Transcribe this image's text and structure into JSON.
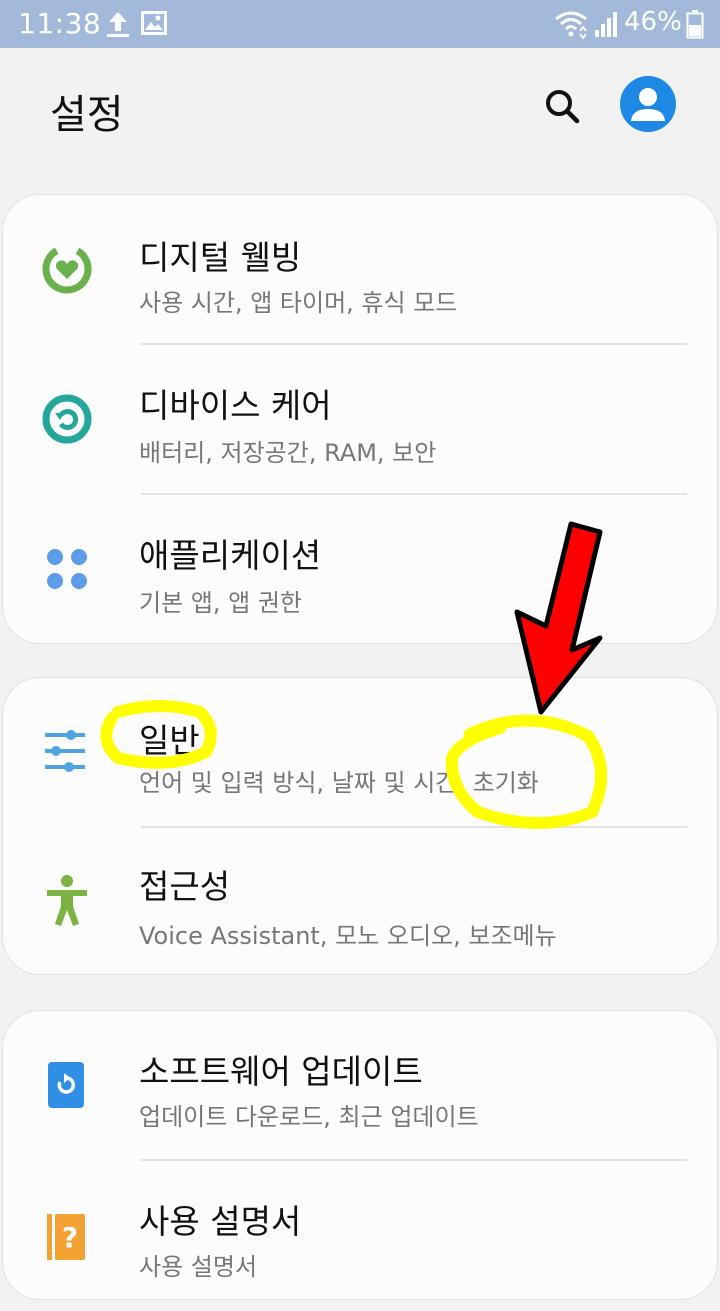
{
  "status_bar": {
    "time": "11:38",
    "battery": "46%"
  },
  "header": {
    "title": "설정"
  },
  "cards": [
    {
      "items": [
        {
          "title": "디지털 웰빙",
          "subtitle": "사용 시간, 앱 타이머, 휴식 모드",
          "icon": "digital-wellbeing-icon",
          "color": "#6ab04c"
        },
        {
          "title": "디바이스 케어",
          "subtitle": "배터리, 저장공간, RAM, 보안",
          "icon": "device-care-icon",
          "color": "#26a69a"
        },
        {
          "title": "애플리케이션",
          "subtitle": "기본 앱, 앱 권한",
          "icon": "apps-icon",
          "color": "#5c9be6"
        }
      ]
    },
    {
      "items": [
        {
          "title": "일반",
          "subtitle": "언어 및 입력 방식, 날짜 및 시간, 초기화",
          "icon": "sliders-icon",
          "color": "#4fa3e0"
        },
        {
          "title": "접근성",
          "subtitle": "Voice Assistant, 모노 오디오, 보조메뉴",
          "icon": "accessibility-icon",
          "color": "#7cb342"
        }
      ]
    },
    {
      "items": [
        {
          "title": "소프트웨어 업데이트",
          "subtitle": "업데이트 다운로드, 최근 업데이트",
          "icon": "software-update-icon",
          "color": "#2f8fe6"
        },
        {
          "title": "사용 설명서",
          "subtitle": "사용 설명서",
          "icon": "user-manual-icon",
          "color": "#f5a234"
        }
      ]
    }
  ],
  "colors": {
    "status_bar": "#a3b9d9",
    "background": "#f2f2f2",
    "card": "#fcfcfc",
    "avatar": "#1e88e5",
    "annotation_highlight": "#ffff00",
    "annotation_arrow": "#ff0000"
  }
}
